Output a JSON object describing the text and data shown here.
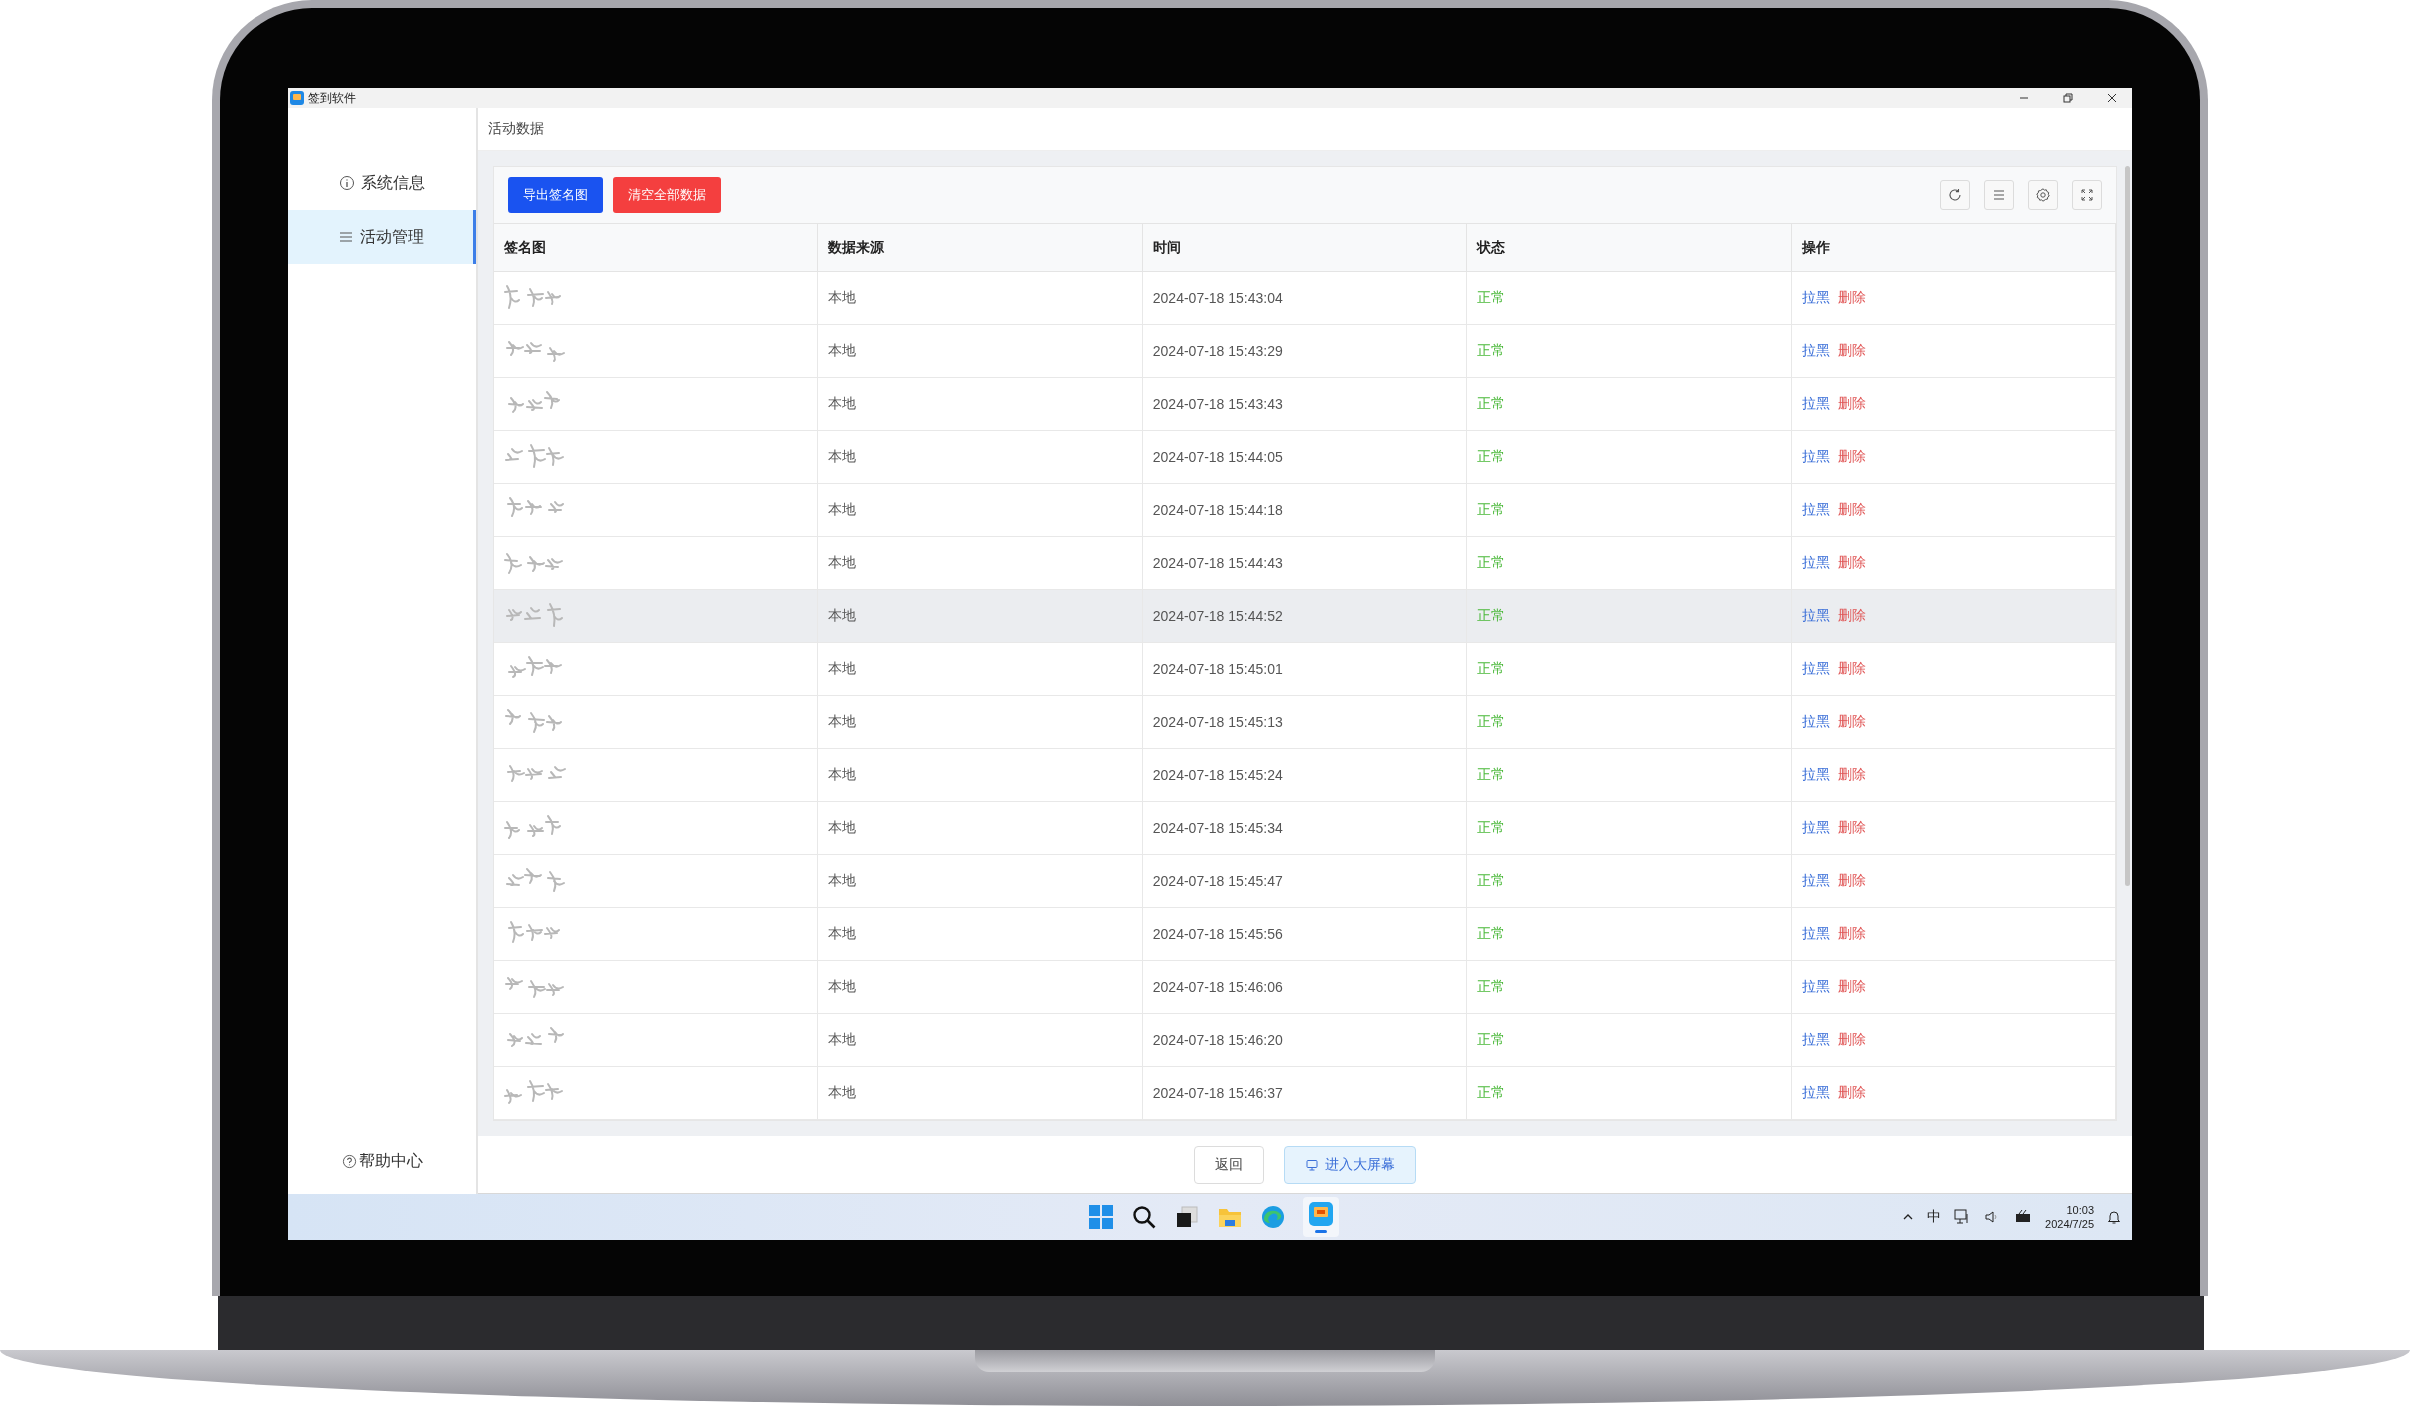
{
  "window": {
    "title": "签到软件"
  },
  "sidebar": {
    "items": [
      {
        "label": "系统信息",
        "selected": false
      },
      {
        "label": "活动管理",
        "selected": true
      }
    ],
    "help": "帮助中心"
  },
  "page_title": "活动数据",
  "toolbar": {
    "buttons": [
      {
        "label": "导出签名图",
        "kind": "primary"
      },
      {
        "label": "清空全部数据",
        "kind": "danger"
      }
    ]
  },
  "table": {
    "columns": [
      "签名图",
      "数据来源",
      "时间",
      "状态",
      "操作"
    ],
    "rows": [
      {
        "source": "本地",
        "time": "2024-07-18 15:43:04",
        "status": "正常",
        "actions": [
          "拉黑",
          "删除"
        ],
        "highlighted": false
      },
      {
        "source": "本地",
        "time": "2024-07-18 15:43:29",
        "status": "正常",
        "actions": [
          "拉黑",
          "删除"
        ],
        "highlighted": false
      },
      {
        "source": "本地",
        "time": "2024-07-18 15:43:43",
        "status": "正常",
        "actions": [
          "拉黑",
          "删除"
        ],
        "highlighted": false
      },
      {
        "source": "本地",
        "time": "2024-07-18 15:44:05",
        "status": "正常",
        "actions": [
          "拉黑",
          "删除"
        ],
        "highlighted": false
      },
      {
        "source": "本地",
        "time": "2024-07-18 15:44:18",
        "status": "正常",
        "actions": [
          "拉黑",
          "删除"
        ],
        "highlighted": false
      },
      {
        "source": "本地",
        "time": "2024-07-18 15:44:43",
        "status": "正常",
        "actions": [
          "拉黑",
          "删除"
        ],
        "highlighted": false
      },
      {
        "source": "本地",
        "time": "2024-07-18 15:44:52",
        "status": "正常",
        "actions": [
          "拉黑",
          "删除"
        ],
        "highlighted": true
      },
      {
        "source": "本地",
        "time": "2024-07-18 15:45:01",
        "status": "正常",
        "actions": [
          "拉黑",
          "删除"
        ],
        "highlighted": false
      },
      {
        "source": "本地",
        "time": "2024-07-18 15:45:13",
        "status": "正常",
        "actions": [
          "拉黑",
          "删除"
        ],
        "highlighted": false
      },
      {
        "source": "本地",
        "time": "2024-07-18 15:45:24",
        "status": "正常",
        "actions": [
          "拉黑",
          "删除"
        ],
        "highlighted": false
      },
      {
        "source": "本地",
        "time": "2024-07-18 15:45:34",
        "status": "正常",
        "actions": [
          "拉黑",
          "删除"
        ],
        "highlighted": false
      },
      {
        "source": "本地",
        "time": "2024-07-18 15:45:47",
        "status": "正常",
        "actions": [
          "拉黑",
          "删除"
        ],
        "highlighted": false
      },
      {
        "source": "本地",
        "time": "2024-07-18 15:45:56",
        "status": "正常",
        "actions": [
          "拉黑",
          "删除"
        ],
        "highlighted": false
      },
      {
        "source": "本地",
        "time": "2024-07-18 15:46:06",
        "status": "正常",
        "actions": [
          "拉黑",
          "删除"
        ],
        "highlighted": false
      },
      {
        "source": "本地",
        "time": "2024-07-18 15:46:20",
        "status": "正常",
        "actions": [
          "拉黑",
          "删除"
        ],
        "highlighted": false
      },
      {
        "source": "本地",
        "time": "2024-07-18 15:46:37",
        "status": "正常",
        "actions": [
          "拉黑",
          "删除"
        ],
        "highlighted": false
      }
    ]
  },
  "footer": {
    "buttons": [
      {
        "label": "返回",
        "kind": "default"
      },
      {
        "label": "进入大屏幕",
        "kind": "primary"
      }
    ]
  },
  "taskbar": {
    "input_method": "中",
    "time": "10:03",
    "date": "2024/7/25"
  }
}
